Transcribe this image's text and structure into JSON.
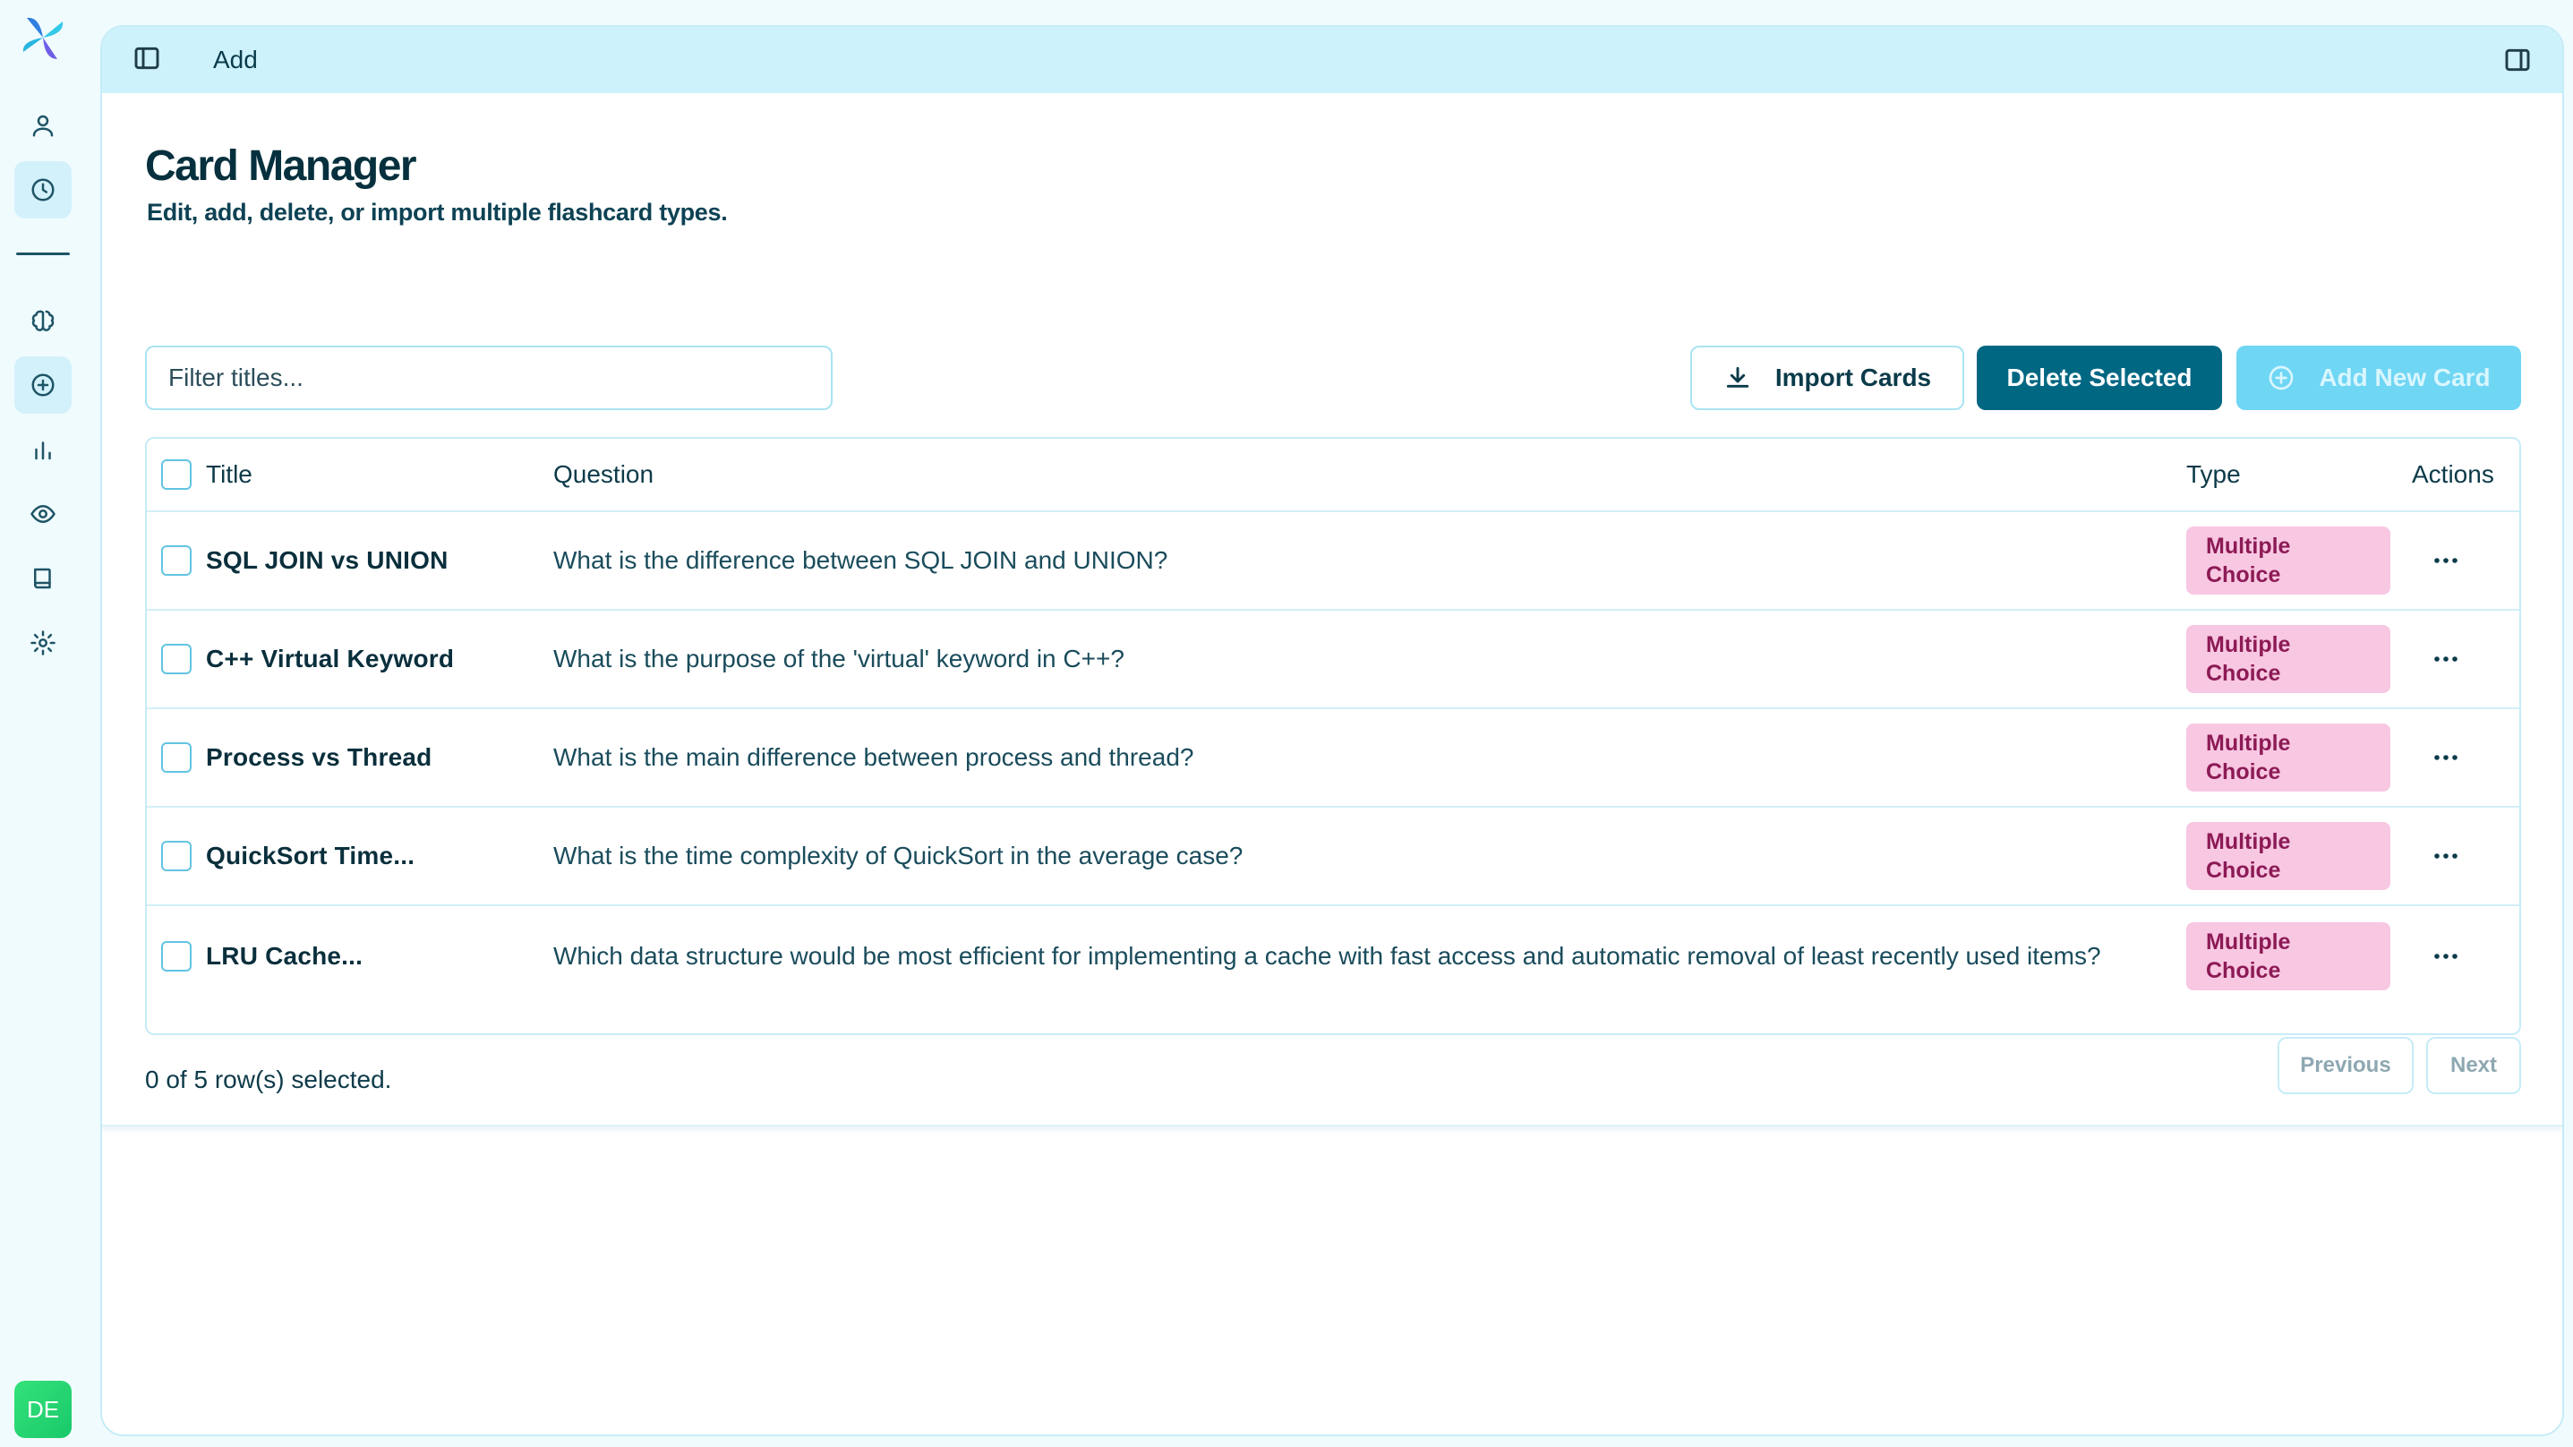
{
  "header": {
    "breadcrumb": "Add"
  },
  "sidebar": {
    "items": [
      {
        "name": "profile",
        "icon": "user-icon"
      },
      {
        "name": "history",
        "icon": "clock-icon"
      },
      {
        "name": "learn",
        "icon": "brain-icon"
      },
      {
        "name": "add",
        "icon": "plus-circle-icon"
      },
      {
        "name": "stats",
        "icon": "bar-chart-icon"
      },
      {
        "name": "review",
        "icon": "eye-icon"
      },
      {
        "name": "library",
        "icon": "book-icon"
      },
      {
        "name": "settings",
        "icon": "gear-icon"
      }
    ],
    "avatar_initials": "DE"
  },
  "page": {
    "title": "Card Manager",
    "subtitle": "Edit, add, delete, or import multiple flashcard types."
  },
  "toolbar": {
    "filter_placeholder": "Filter titles...",
    "import_label": "Import Cards",
    "delete_label": "Delete Selected",
    "add_label": "Add New Card"
  },
  "table": {
    "columns": {
      "title": "Title",
      "question": "Question",
      "type": "Type",
      "actions": "Actions"
    },
    "rows": [
      {
        "title": "SQL JOIN vs UNION",
        "question": "What is the difference between SQL JOIN and UNION?",
        "type_line1": "Multiple",
        "type_line2": "Choice"
      },
      {
        "title": "C++ Virtual Keyword",
        "question": "What is the purpose of the 'virtual' keyword in C++?",
        "type_line1": "Multiple",
        "type_line2": "Choice"
      },
      {
        "title": "Process vs Thread",
        "question": "What is the main difference between process and thread?",
        "type_line1": "Multiple",
        "type_line2": "Choice"
      },
      {
        "title": "QuickSort Time...",
        "question": "What is the time complexity of QuickSort in the average case?",
        "type_line1": "Multiple",
        "type_line2": "Choice"
      },
      {
        "title": "LRU Cache...",
        "question": "Which data structure would be most efficient for implementing a cache with fast access and automatic removal of least recently used items?",
        "type_line1": "Multiple",
        "type_line2": "Choice"
      }
    ]
  },
  "footer": {
    "selection_status": "0 of 5 row(s) selected.",
    "previous_label": "Previous",
    "next_label": "Next"
  },
  "colors": {
    "primary": "#006783",
    "accent_light": "#6fd6f4",
    "badge_bg": "#f8c7e2",
    "badge_text": "#8c1a55",
    "topbar_bg": "#cdf2fc"
  }
}
